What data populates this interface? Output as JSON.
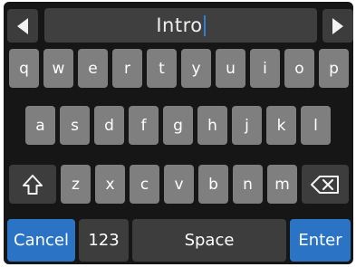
{
  "text_field": {
    "value": "Intro"
  },
  "nav": {
    "left_icon": "triangle-left-icon",
    "right_icon": "triangle-right-icon"
  },
  "keyboard": {
    "row1": [
      "q",
      "w",
      "e",
      "r",
      "t",
      "y",
      "u",
      "i",
      "o",
      "p"
    ],
    "row2": [
      "a",
      "s",
      "d",
      "f",
      "g",
      "h",
      "j",
      "k",
      "l"
    ],
    "row3": [
      "z",
      "x",
      "c",
      "v",
      "b",
      "n",
      "m"
    ],
    "shift_icon": "shift-arrow-icon",
    "backspace_icon": "backspace-icon",
    "cancel_label": "Cancel",
    "numbers_label": "123",
    "space_label": "Space",
    "enter_label": "Enter"
  },
  "colors": {
    "background": "#161616",
    "letter_key": "#7f7f7f",
    "function_key": "#3d3d3d",
    "accent_key": "#2b73c5",
    "caret": "#2f7fd6"
  }
}
